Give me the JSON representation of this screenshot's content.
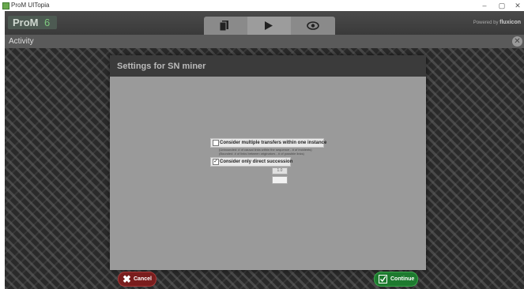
{
  "window": {
    "title": "ProM UITopia",
    "minimize": "–",
    "maximize": "▢",
    "close": "✕"
  },
  "header": {
    "logo": "ProM",
    "version": "6",
    "toolbar": [
      "workspace-icon",
      "play-icon",
      "eye-icon"
    ],
    "brand_prefix": "Powered by",
    "brand_name": "fluxicon"
  },
  "activity": {
    "label": "Activity",
    "close": "✕"
  },
  "dialog": {
    "title": "Settings for SN miner",
    "options": [
      {
        "label": "Consider multiple transfers within one instance",
        "checked": false,
        "hint_line1": "(Unbounded: # of causal links within the sequence - # of incidents)",
        "hint_line2": "(Bounded: # of links between originators - # of possible links)"
      },
      {
        "label": "Consider only direct succession",
        "checked": true
      }
    ],
    "fields": [
      {
        "value": "1.0"
      },
      {
        "value": ""
      }
    ],
    "cancel_label": "Cancel",
    "continue_label": "Continue"
  },
  "colors": {
    "cancel": "#7a1e1e",
    "continue": "#1e7a2f",
    "logo_version": "#7fc97f"
  }
}
